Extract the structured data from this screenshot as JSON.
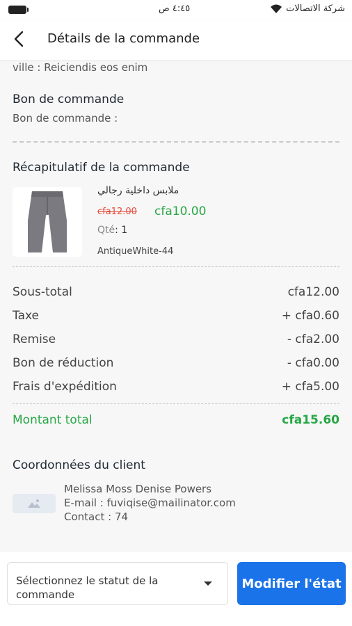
{
  "status_bar": {
    "time": "٤:٤٥ ص",
    "carrier": "شركة الاتصالات"
  },
  "header": {
    "title": "Détails de la commande"
  },
  "address": {
    "city_line": "ville : Reiciendis eos enim"
  },
  "purchase_order": {
    "heading": "Bon de commande",
    "line": "Bon de commande :"
  },
  "summary": {
    "heading": "Récapitulatif de la commande",
    "item": {
      "name": "ملابس داخلية رجالي",
      "old_price": "cfa12.00",
      "new_price": "cfa10.00",
      "qty_label": "Qté",
      "qty_value": ": 1",
      "variant": "AntiqueWhite-44"
    },
    "rows": [
      {
        "label": "Sous-total",
        "value": "cfa12.00"
      },
      {
        "label": "Taxe",
        "value": "+ cfa0.60"
      },
      {
        "label": "Remise",
        "value": "- cfa2.00"
      },
      {
        "label": "Bon de réduction",
        "value": "- cfa0.00"
      },
      {
        "label": "Frais d'expédition",
        "value": "+ cfa5.00"
      }
    ],
    "total_label": "Montant total",
    "total_value": "cfa15.60"
  },
  "customer": {
    "heading": "Coordonnées du client",
    "name": "Melissa Moss Denise Powers",
    "email_line": "E-mail : fuviqise@mailinator.com",
    "contact_line": "Contact : 74"
  },
  "actions": {
    "status_select_placeholder": "Sélectionnez le statut de la commande",
    "update_button": "Modifier l'état"
  },
  "colors": {
    "accent": "#1a73e8",
    "discount_price": "#27a745",
    "strike_price": "#e74c3c"
  }
}
